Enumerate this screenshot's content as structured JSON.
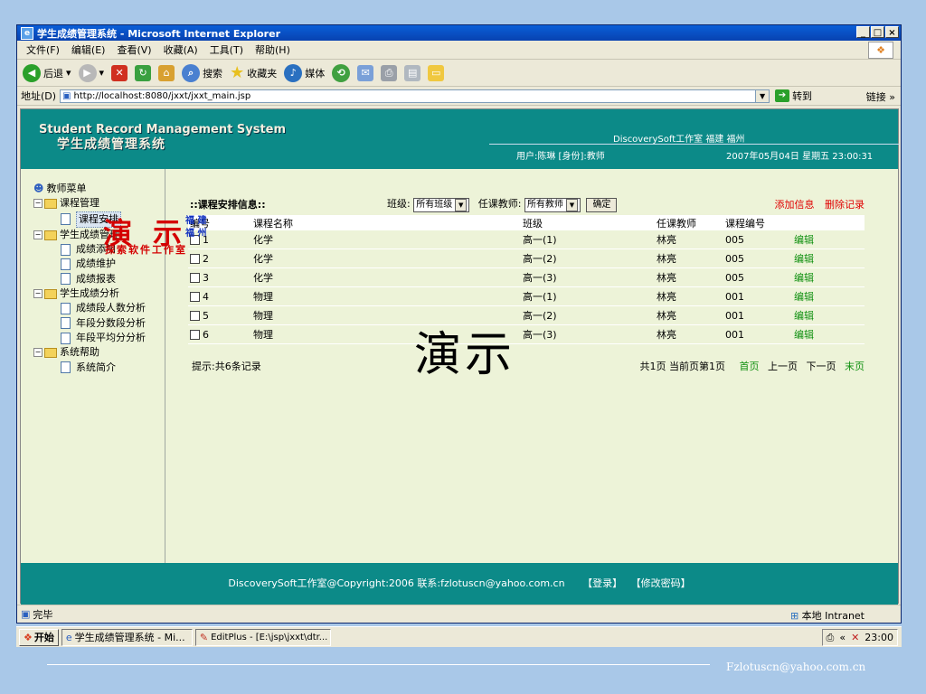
{
  "window": {
    "title": "学生成绩管理系统 - Microsoft Internet Explorer",
    "controls": [
      "_",
      "□",
      "×"
    ]
  },
  "menu": [
    "文件(F)",
    "编辑(E)",
    "查看(V)",
    "收藏(A)",
    "工具(T)",
    "帮助(H)"
  ],
  "toolbar": {
    "back": "后退",
    "search": "搜索",
    "favorites": "收藏夹",
    "media": "媒体"
  },
  "address": {
    "label": "地址(D)",
    "url": "http://localhost:8080/jxxt/jxxt_main.jsp",
    "go": "转到",
    "links": "链接 »"
  },
  "header": {
    "title_en": "Student Record Management System",
    "title_cn": "学生成绩管理系统",
    "studio": "DiscoverySoft工作室 福建 福州",
    "user": "用户:陈琳 [身份]:教师",
    "datetime": "2007年05月04日 星期五 23:00:31"
  },
  "sidebar": {
    "root": "教师菜单",
    "groups": [
      {
        "label": "课程管理",
        "items": [
          "课程安排"
        ]
      },
      {
        "label": "学生成绩管理",
        "items": [
          "成绩添加",
          "成绩维护",
          "成绩报表"
        ]
      },
      {
        "label": "学生成绩分析",
        "items": [
          "成绩段人数分析",
          "年段分数段分析",
          "年段平均分分析"
        ]
      },
      {
        "label": "系统帮助",
        "items": [
          "系统简介"
        ]
      }
    ],
    "logo_main": "演 示",
    "logo_side": [
      "福 建",
      "福 州"
    ],
    "logo_sub": "探索软件工作室"
  },
  "content": {
    "section_title": "::课程安排信息::",
    "class_label": "班级:",
    "class_value": "所有班级",
    "teacher_label": "任课教师:",
    "teacher_value": "所有教师",
    "ok": "确定",
    "add": "添加信息",
    "delete": "删除记录",
    "columns": [
      "编号",
      "课程名称",
      "班级",
      "任课教师",
      "课程编号",
      ""
    ],
    "rows": [
      {
        "id": "1",
        "course": "化学",
        "class": "高一(1)",
        "teacher": "林亮",
        "code": "005",
        "action": "编辑"
      },
      {
        "id": "2",
        "course": "化学",
        "class": "高一(2)",
        "teacher": "林亮",
        "code": "005",
        "action": "编辑"
      },
      {
        "id": "3",
        "course": "化学",
        "class": "高一(3)",
        "teacher": "林亮",
        "code": "005",
        "action": "编辑"
      },
      {
        "id": "4",
        "course": "物理",
        "class": "高一(1)",
        "teacher": "林亮",
        "code": "001",
        "action": "编辑"
      },
      {
        "id": "5",
        "course": "物理",
        "class": "高一(2)",
        "teacher": "林亮",
        "code": "001",
        "action": "编辑"
      },
      {
        "id": "6",
        "course": "物理",
        "class": "高一(3)",
        "teacher": "林亮",
        "code": "001",
        "action": "编辑"
      }
    ],
    "tip": "提示:共6条记录",
    "pager_info": "共1页 当前页第1页",
    "first": "首页",
    "prev": "上一页",
    "next": "下一页",
    "last": "末页"
  },
  "watermark": "演示",
  "footer": {
    "copyright": "DiscoverySoft工作室@Copyright:2006 联系:fzlotuscn@yahoo.com.cn",
    "login": "【登录】",
    "change_pwd": "【修改密码】"
  },
  "status": {
    "text": "完毕",
    "zone": "本地 Intranet"
  },
  "taskbar": {
    "start": "开始",
    "task1": "学生成绩管理系统 - Mi...",
    "task2": "EditPlus - [E:\\jsp\\jxxt\\dtr...",
    "clock": "23:00"
  },
  "slide_email": "Fzlotuscn@yahoo.com.cn"
}
